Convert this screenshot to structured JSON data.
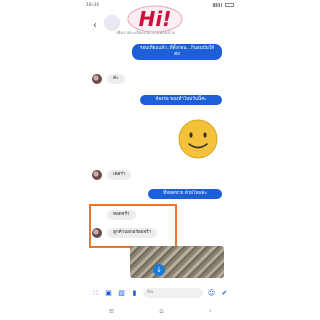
{
  "status_bar": {
    "time": "18:34"
  },
  "header": {
    "subtitle": "เพิ่มรายละเอียดเกี่ยวกับเพื่อนบ้าย",
    "sticker_text": "Hi!"
  },
  "messages": [
    {
      "dir": "out",
      "text": "รอบเที่ยมแล้ว..ที่ตั้งก่อน...กินอนบ้นให้ต่อ"
    },
    {
      "dir": "in",
      "text": "ค่ะ"
    },
    {
      "dir": "out",
      "text": "ห้องรอ ของทำไหม่วันนี้ค่ะ"
    },
    {
      "dir": "in",
      "text": "เคอร่า"
    },
    {
      "dir": "out",
      "text": "ที่หอดขาย ด้วยไหมค่ะ"
    },
    {
      "dir": "in",
      "text": "ทอดจร้า"
    },
    {
      "dir": "in",
      "text": "ลูกค้าบอกอร่อยจร้า"
    }
  ],
  "composer": {
    "placeholder": "Aa"
  },
  "icons": [
    "back-arrow-icon",
    "menu-grid-icon",
    "camera-icon",
    "photo-icon",
    "mic-icon",
    "emoji-icon",
    "like-icon",
    "recent-apps-icon",
    "home-icon",
    "back-nav-icon"
  ]
}
